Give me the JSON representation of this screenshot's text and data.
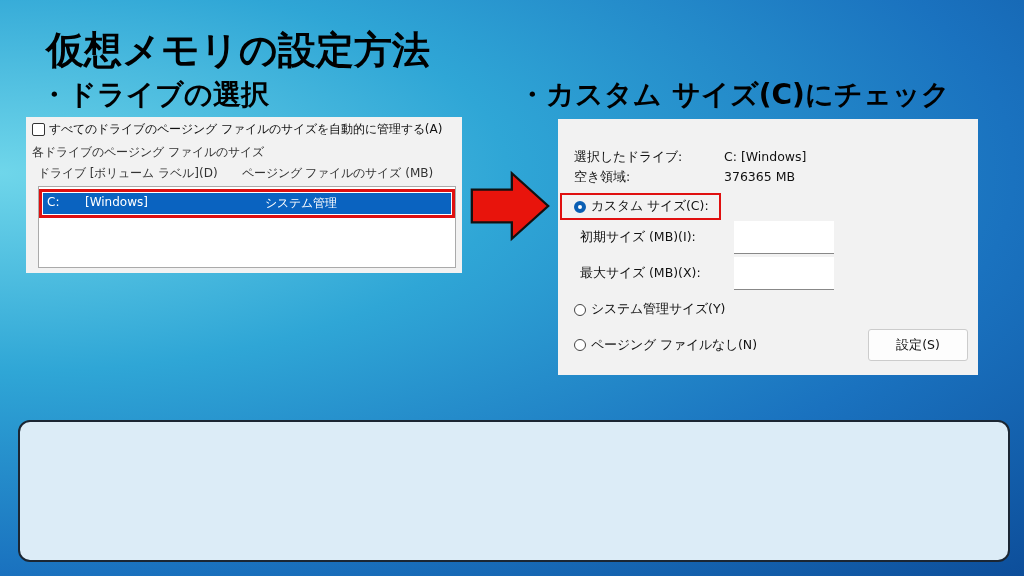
{
  "title": "仮想メモリの設定方法",
  "steps": [
    {
      "heading": "・ドライブの選択"
    },
    {
      "heading": "・カスタム サイズ(C)にチェック"
    }
  ],
  "drive_panel": {
    "auto_manage": {
      "label": "すべてのドライブのページング ファイルのサイズを自動的に管理する(A)",
      "checked": false
    },
    "group_label": "各ドライブのページング ファイルのサイズ",
    "columns": [
      "ドライブ [ボリューム ラベル](D)",
      "ページング ファイルのサイズ (MB)"
    ],
    "drives": [
      {
        "drive": "C:",
        "label": "[Windows]",
        "size": "システム管理",
        "selected": true,
        "highlighted": true
      }
    ]
  },
  "size_panel": {
    "info": [
      {
        "label": "選択したドライブ:",
        "value": "C:  [Windows]"
      },
      {
        "label": "空き領域:",
        "value": "376365 MB"
      }
    ],
    "options": [
      {
        "label": "カスタム サイズ(C):",
        "selected": true,
        "highlighted": true,
        "fields": [
          {
            "label": "初期サイズ (MB)(I):"
          },
          {
            "label": "最大サイズ (MB)(X):"
          }
        ]
      },
      {
        "label": "システム管理サイズ(Y)",
        "selected": false,
        "highlighted": false
      },
      {
        "label": "ページング ファイルなし(N)",
        "selected": false,
        "highlighted": false
      }
    ],
    "set_button": "設定(S)"
  }
}
